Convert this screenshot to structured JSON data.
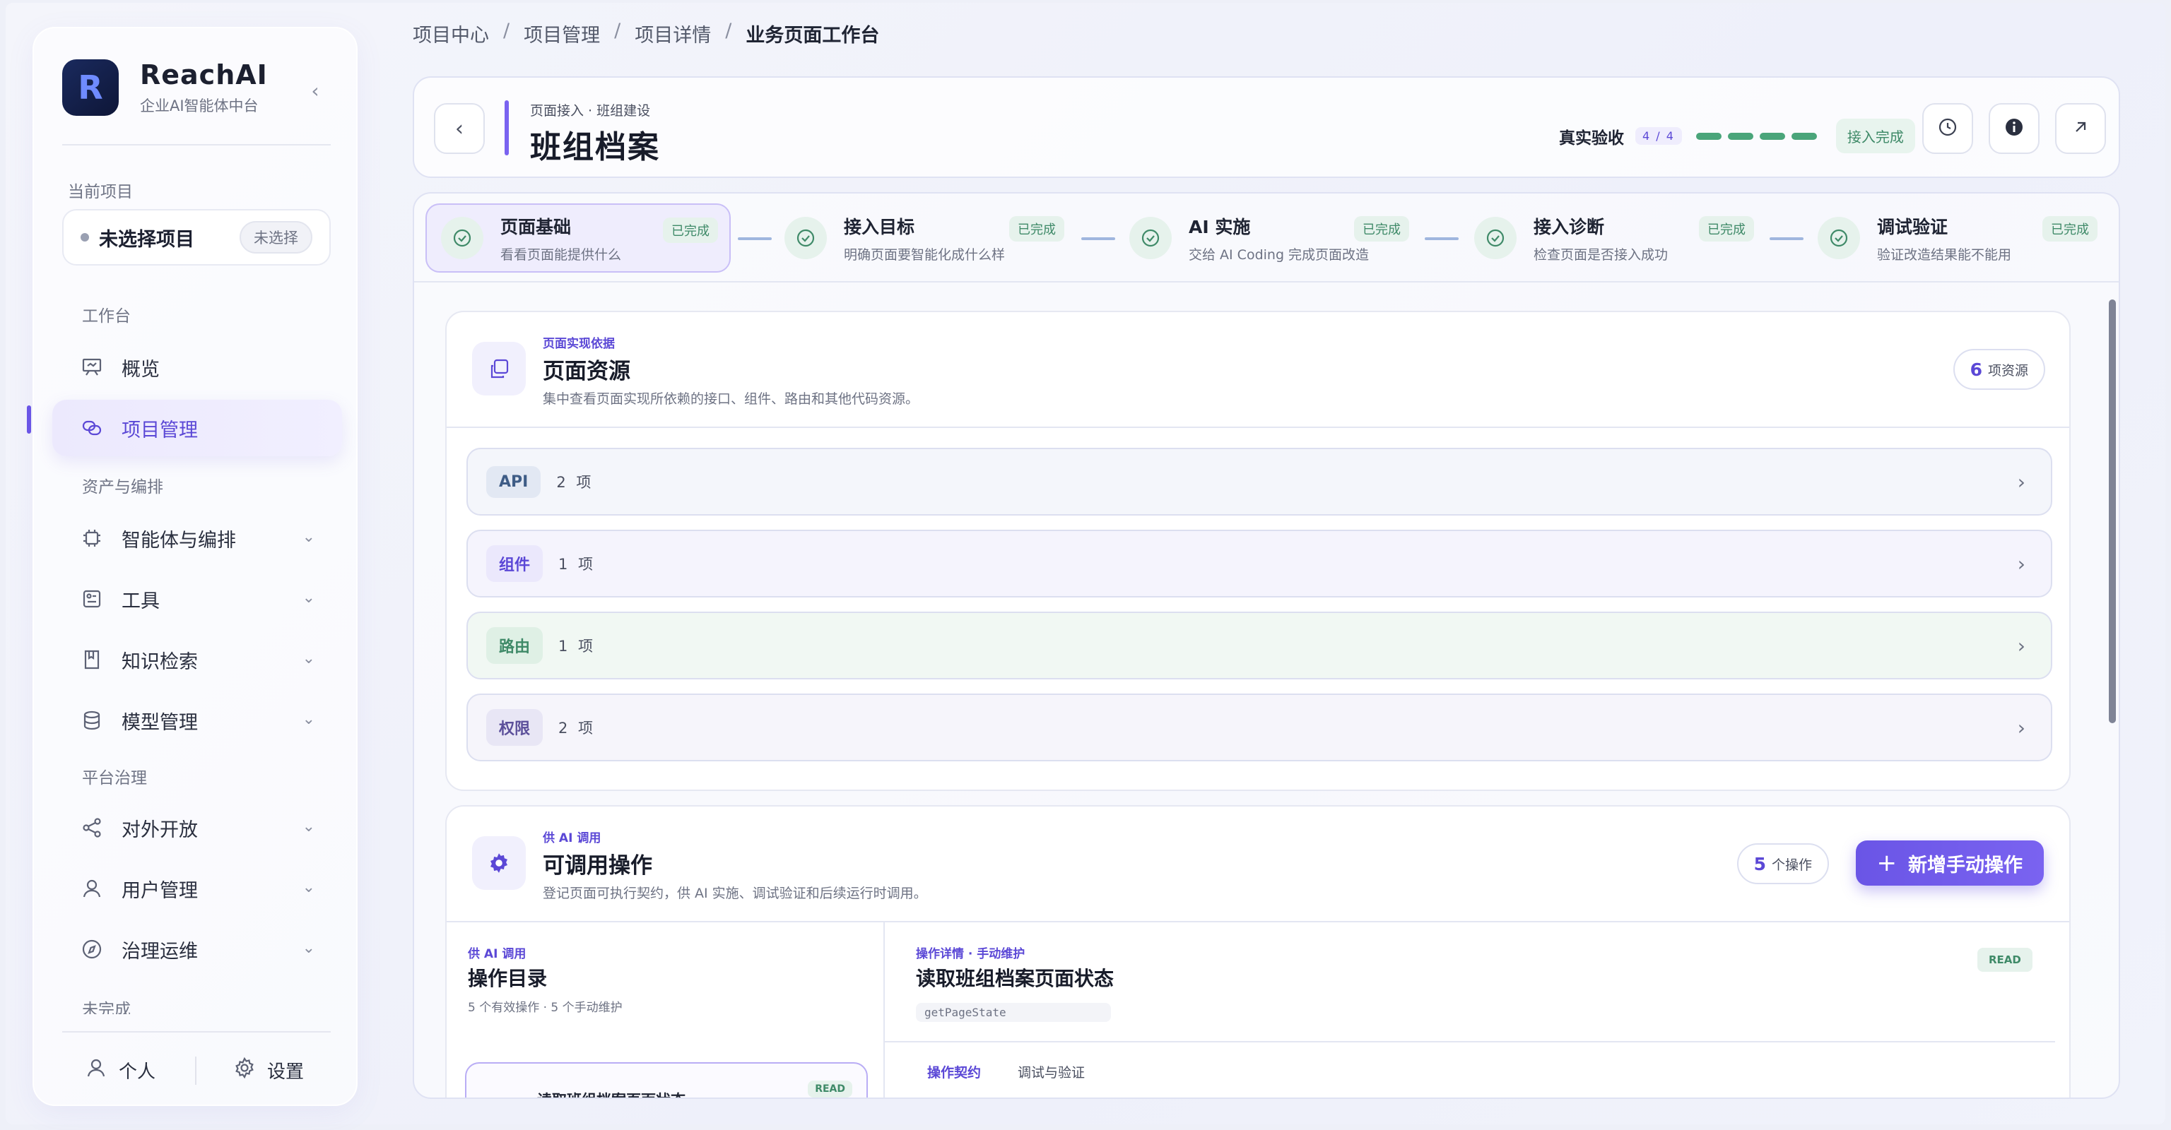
{
  "brand": {
    "name": "ReachAI",
    "subtitle": "企业AI智能体中台"
  },
  "sidebar": {
    "current_project_label": "当前项目",
    "project_name": "未选择项目",
    "project_tag": "未选择",
    "groups": [
      "工作台",
      "资产与编排",
      "平台治理",
      "未完成"
    ],
    "items": [
      {
        "label": "概览",
        "icon": "presentation-icon"
      },
      {
        "label": "项目管理",
        "icon": "link-icon",
        "active": true
      },
      {
        "label": "智能体与编排",
        "icon": "chip-icon"
      },
      {
        "label": "工具",
        "icon": "tool-icon"
      },
      {
        "label": "知识检索",
        "icon": "book-icon"
      },
      {
        "label": "模型管理",
        "icon": "database-icon"
      },
      {
        "label": "对外开放",
        "icon": "share-icon"
      },
      {
        "label": "用户管理",
        "icon": "user-icon"
      },
      {
        "label": "治理运维",
        "icon": "compass-icon"
      }
    ],
    "footer": {
      "personal": "个人",
      "settings": "设置"
    }
  },
  "breadcrumb": [
    "项目中心",
    "项目管理",
    "项目详情",
    "业务页面工作台"
  ],
  "header": {
    "subtitle": "页面接入 · 班组建设",
    "title": "班组档案",
    "verify_label": "真实验收",
    "verify_count": "4 / 4",
    "verify_progress": 1.0,
    "status": "接入完成"
  },
  "steps": [
    {
      "title": "页面基础",
      "desc": "看看页面能提供什么",
      "badge": "已完成"
    },
    {
      "title": "接入目标",
      "desc": "明确页面要智能化成什么样",
      "badge": "已完成"
    },
    {
      "title": "AI 实施",
      "desc": "交给 AI Coding 完成页面改造",
      "badge": "已完成"
    },
    {
      "title": "接入诊断",
      "desc": "检查页面是否接入成功",
      "badge": "已完成"
    },
    {
      "title": "调试验证",
      "desc": "验证改造结果能不能用",
      "badge": "已完成"
    }
  ],
  "resources": {
    "kicker": "页面实现依据",
    "title": "页面资源",
    "desc": "集中查看页面实现所依赖的接口、组件、路由和其他代码资源。",
    "count": "6",
    "count_unit": "项资源",
    "rows": [
      {
        "tag": "API",
        "count": "2 项"
      },
      {
        "tag": "组件",
        "count": "1 项"
      },
      {
        "tag": "路由",
        "count": "1 项"
      },
      {
        "tag": "权限",
        "count": "2 项"
      }
    ]
  },
  "operations": {
    "kicker": "供 AI 调用",
    "title": "可调用操作",
    "desc": "登记页面可执行契约，供 AI 实施、调试验证和后续运行时调用。",
    "count": "5",
    "count_unit": "个操作",
    "add_label": "新增手动操作",
    "catalog": {
      "kicker": "供 AI 调用",
      "title": "操作目录",
      "desc": "5 个有效操作 · 5 个手动维护"
    },
    "detail": {
      "kicker": "操作详情 · 手动维护",
      "title": "读取班组档案页面状态",
      "code": "getPageState",
      "badge": "READ"
    },
    "tabs": [
      "操作契约",
      "调试与验证"
    ],
    "list_item": {
      "title": "读取班组档案页面状态",
      "badge": "READ"
    }
  },
  "colors": {
    "accent": "#6a55e6",
    "success": "#3f8a68"
  }
}
